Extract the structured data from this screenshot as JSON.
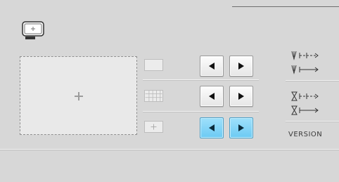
{
  "side_panel": {
    "version_label": "VERSION"
  },
  "icons": {
    "hoop": "embroidery-hoop-icon",
    "preview_center": "plus-cross-icon",
    "needle_bar_dashed": "needle-move-dashed-icon",
    "needle_bar_solid": "needle-move-solid-icon",
    "hourglass_dashed": "hourglass-move-dashed-icon",
    "hourglass_solid": "hourglass-move-solid-icon",
    "left_arrow": "left-arrow-icon",
    "right_arrow": "right-arrow-icon"
  },
  "colors": {
    "background": "#d7d7d7",
    "active_button": "#7fd2f6",
    "arrow": "#111111"
  },
  "rows": [
    {
      "name": "background-setting",
      "active": false
    },
    {
      "name": "grid-setting",
      "active": false
    },
    {
      "name": "cursor-setting",
      "active": true
    }
  ]
}
